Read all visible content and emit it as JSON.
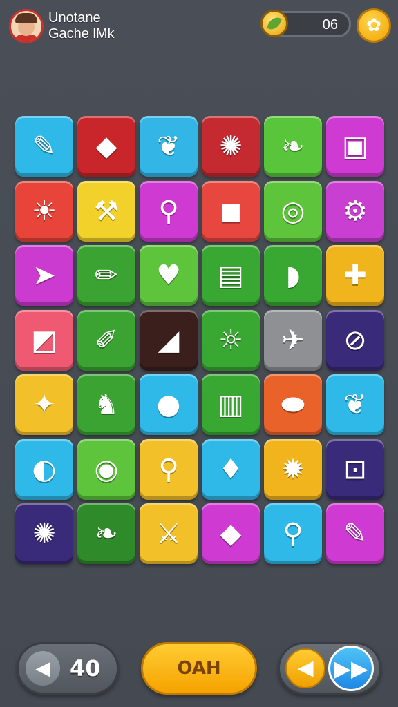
{
  "header": {
    "player_name_line1": "Unotane",
    "player_name_line2": "Gache lMk",
    "coin_count": "06",
    "settings_icon": "gear-icon"
  },
  "board": {
    "rows": [
      [
        {
          "color": "#2fb9e8",
          "icon": "brush-icon",
          "glyph": "✎"
        },
        {
          "color": "#c8262a",
          "icon": "crystal-icon",
          "glyph": "◆"
        },
        {
          "color": "#33b6e6",
          "icon": "leaf-icon",
          "glyph": "❦"
        },
        {
          "color": "#c42a2f",
          "icon": "fan-icon",
          "glyph": "✺"
        },
        {
          "color": "#59c53a",
          "icon": "leaf-icon",
          "glyph": "❧"
        },
        {
          "color": "#cf3bd2",
          "icon": "camera-icon",
          "glyph": "▣"
        }
      ],
      [
        {
          "color": "#e8443a",
          "icon": "torch-icon",
          "glyph": "☀"
        },
        {
          "color": "#f2d22a",
          "icon": "hammer-icon",
          "glyph": "⚒"
        },
        {
          "color": "#cf3bd2",
          "icon": "magnifier-icon",
          "glyph": "⚲"
        },
        {
          "color": "#e8473f",
          "icon": "cube-icon",
          "glyph": "◼"
        },
        {
          "color": "#5dc43b",
          "icon": "ring-icon",
          "glyph": "◎"
        },
        {
          "color": "#c93fd2",
          "icon": "wrench-icon",
          "glyph": "⚙"
        }
      ],
      [
        {
          "color": "#cc3bd0",
          "icon": "dolphin-icon",
          "glyph": "➤"
        },
        {
          "color": "#3aa331",
          "icon": "pencil-icon",
          "glyph": "✏"
        },
        {
          "color": "#5dc43b",
          "icon": "heart-icon",
          "glyph": "♥"
        },
        {
          "color": "#39a832",
          "icon": "radio-icon",
          "glyph": "▤"
        },
        {
          "color": "#39a832",
          "icon": "bottle-icon",
          "glyph": "◗"
        },
        {
          "color": "#f0b41d",
          "icon": "plug-icon",
          "glyph": "✚"
        }
      ],
      [
        {
          "color": "#ef5a72",
          "icon": "eraser-icon",
          "glyph": "◩"
        },
        {
          "color": "#3aa331",
          "icon": "marker-icon",
          "glyph": "✐"
        },
        {
          "color": "#3a1f1c",
          "icon": "arrow-icon",
          "glyph": "◢"
        },
        {
          "color": "#39a832",
          "icon": "sun-icon",
          "glyph": "☼"
        },
        {
          "color": "#8e9094",
          "icon": "rocket-icon",
          "glyph": "✈"
        },
        {
          "color": "#3a2a7a",
          "icon": "compass-icon",
          "glyph": "⊘"
        }
      ],
      [
        {
          "color": "#f2c12a",
          "icon": "gem-icon",
          "glyph": "✦"
        },
        {
          "color": "#3aa331",
          "icon": "fox-icon",
          "glyph": "♞"
        },
        {
          "color": "#2fb9e8",
          "icon": "fruit-icon",
          "glyph": "●"
        },
        {
          "color": "#39a832",
          "icon": "book-icon",
          "glyph": "▥"
        },
        {
          "color": "#e8622a",
          "icon": "ufo-icon",
          "glyph": "⬬"
        },
        {
          "color": "#2fb9e8",
          "icon": "feather-icon",
          "glyph": "❦"
        }
      ],
      [
        {
          "color": "#2fb9e8",
          "icon": "shell-icon",
          "glyph": "◐"
        },
        {
          "color": "#5dc43b",
          "icon": "fish-icon",
          "glyph": "◉"
        },
        {
          "color": "#f2c12a",
          "icon": "magnifier-icon",
          "glyph": "⚲"
        },
        {
          "color": "#2fb9e8",
          "icon": "torch-icon",
          "glyph": "♦"
        },
        {
          "color": "#f2b41d",
          "icon": "star-face-icon",
          "glyph": "✹"
        },
        {
          "color": "#3a2a7a",
          "icon": "target-icon",
          "glyph": "⊡"
        }
      ],
      [
        {
          "color": "#3a2a7a",
          "icon": "bird-icon",
          "glyph": "✺"
        },
        {
          "color": "#2f8a2a",
          "icon": "leaf-icon",
          "glyph": "❧"
        },
        {
          "color": "#f2c12a",
          "icon": "swords-icon",
          "glyph": "⚔"
        },
        {
          "color": "#cf3bd2",
          "icon": "crystal-icon",
          "glyph": "◆"
        },
        {
          "color": "#2fb9e8",
          "icon": "magnifier-icon",
          "glyph": "⚲"
        },
        {
          "color": "#cf3bd2",
          "icon": "brush-icon",
          "glyph": "✎"
        }
      ]
    ]
  },
  "footer": {
    "sound_icon": "speaker-icon",
    "sound_value": "40",
    "main_button_label": "OAH",
    "prev_icon": "arrow-left-icon",
    "next_icon": "arrow-right-icon"
  }
}
